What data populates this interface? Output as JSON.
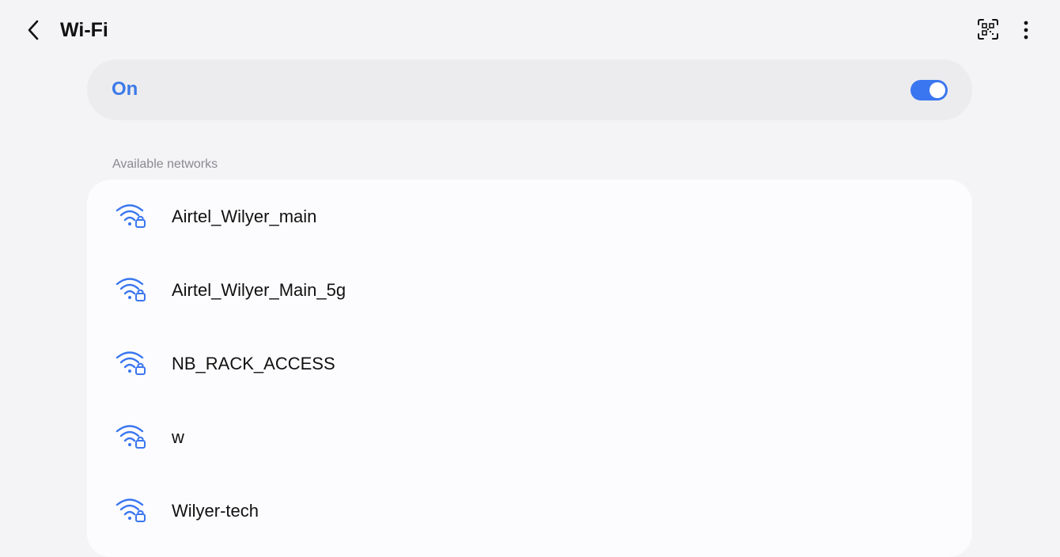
{
  "header": {
    "title": "Wi-Fi",
    "back_icon": "chevron-left-icon",
    "qr_icon": "qr-scan-icon",
    "more_icon": "more-vertical-icon"
  },
  "wifi_toggle": {
    "label": "On",
    "state": true,
    "accent_color": "#3e7ae8"
  },
  "available": {
    "header": "Available networks",
    "icon": "wifi-lock-icon",
    "networks": [
      {
        "name": "Airtel_Wilyer_main"
      },
      {
        "name": "Airtel_Wilyer_Main_5g"
      },
      {
        "name": "NB_RACK_ACCESS"
      },
      {
        "name": "w"
      },
      {
        "name": "Wilyer-tech"
      }
    ]
  }
}
